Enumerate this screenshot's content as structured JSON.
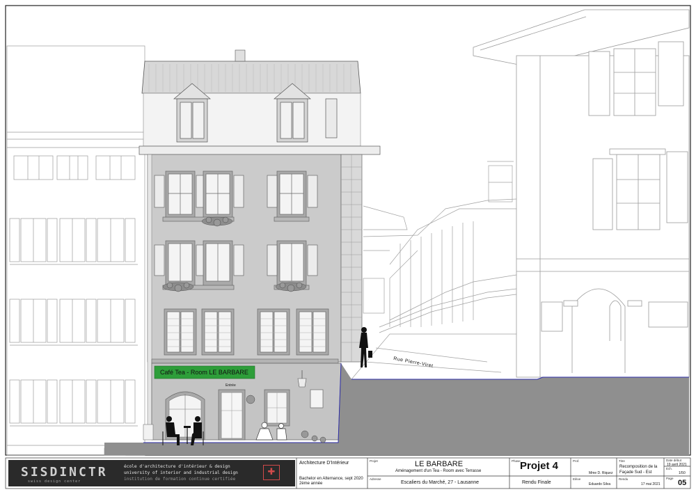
{
  "signage": {
    "cafe_sign": "Café Tea - Room  LE BARBARE",
    "entry": "Entrée",
    "street": "Rue Pierre-Viret"
  },
  "logo": {
    "wordmark": "SISDINCTR",
    "tagline": "swiss design center",
    "school_fr": "école d'architecture d'intérieur & design",
    "school_en": "university of interior and industrial design",
    "school_note": "institution de formation continue certifiée"
  },
  "titleblock": {
    "discipline": "Architecture D'Intérieur",
    "program": "Bachelor en Alternance, sept 2020",
    "year": "2ème année",
    "projet_caption": "Projet",
    "project_name": "LE BARBARE",
    "project_desc": "Aménagement d'un Tea - Room avec Terrasse",
    "adresse_caption": "Adresse",
    "address": "Escaliers du Marché, 27 - Lausanne",
    "phase_caption": "Phase",
    "phase_title": "Projet 4",
    "phase_sub": "Rendu Finale",
    "prof_caption": "Prof.",
    "professor": "Mme D. Riquez",
    "eleve_caption": "Elève",
    "student": "Eduardo Silva",
    "titre_caption": "Titre",
    "sheet_title_line1": "Recomposition de la",
    "sheet_title_line2": "Façade Sud - Est",
    "rendu_caption": "Rendu",
    "render_date": "17 mai 2021",
    "start_caption": "Date début",
    "start_date": "19 avril 2021",
    "echelle_caption": "Ech.",
    "scale": "1/50",
    "page_caption": "Page",
    "page_number": "05"
  },
  "colors": {
    "facade": "#c9c9c9",
    "shutters": "#ececec",
    "sign_green": "#2e9e3a",
    "ground": "#8f8f8f",
    "ground_edge": "#2e2ea8"
  }
}
